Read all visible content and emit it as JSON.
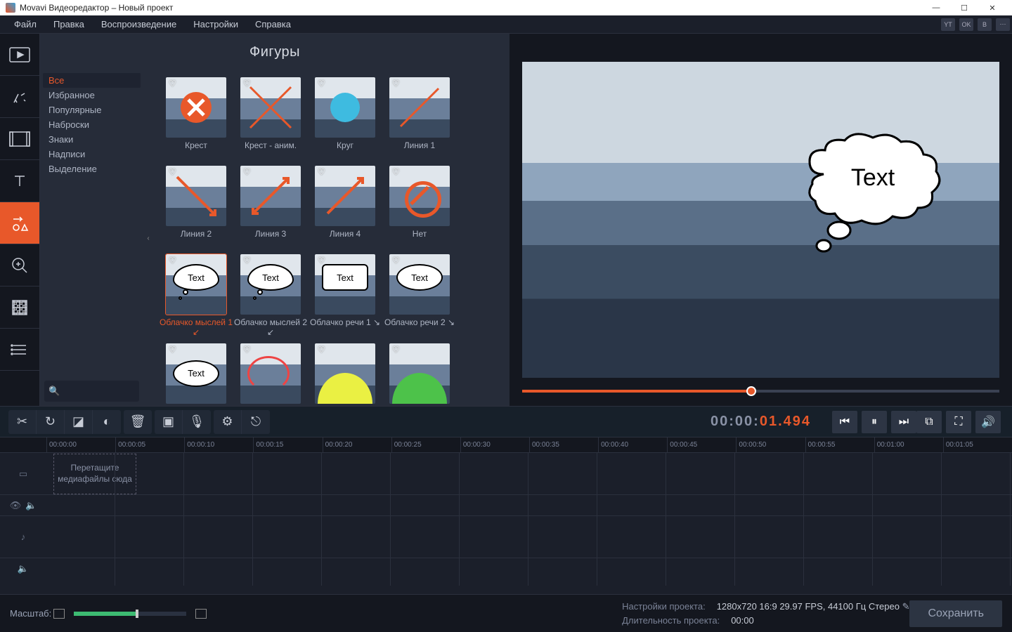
{
  "window": {
    "title": "Movavi Видеоредактор – Новый проект"
  },
  "menu": {
    "items": [
      "Файл",
      "Правка",
      "Воспроизведение",
      "Настройки",
      "Справка"
    ]
  },
  "panel": {
    "title": "Фигуры",
    "categories": [
      "Все",
      "Избранное",
      "Популярные",
      "Наброски",
      "Знаки",
      "Надписи",
      "Выделение"
    ],
    "selected_category": 0,
    "items": [
      {
        "label": "Крест",
        "kind": "cross-x"
      },
      {
        "label": "Крест - аним.",
        "kind": "cross-lines"
      },
      {
        "label": "Круг",
        "kind": "circle"
      },
      {
        "label": "Линия 1",
        "kind": "line1"
      },
      {
        "label": "Линия 2",
        "kind": "line2"
      },
      {
        "label": "Линия 3",
        "kind": "line3"
      },
      {
        "label": "Линия 4",
        "kind": "line4"
      },
      {
        "label": "Нет",
        "kind": "nosign"
      },
      {
        "label": "Облачко мыслей 1 ↙",
        "kind": "cloud",
        "selected": true
      },
      {
        "label": "Облачко мыслей 2 ↙",
        "kind": "cloud"
      },
      {
        "label": "Облачко речи 1 ↘",
        "kind": "rect"
      },
      {
        "label": "Облачко речи 2 ↘",
        "kind": "oval"
      },
      {
        "label": "",
        "kind": "oval2"
      },
      {
        "label": "",
        "kind": "circ-r"
      },
      {
        "label": "",
        "kind": "blob-y"
      },
      {
        "label": "",
        "kind": "blob-g"
      }
    ],
    "bubble_text": "Text"
  },
  "preview": {
    "bubble_text": "Text",
    "scrub_pct": 48,
    "timecode_gray": "00:00:",
    "timecode_orange": "01.494"
  },
  "ruler": [
    "00:00:00",
    "00:00:05",
    "00:00:10",
    "00:00:15",
    "00:00:20",
    "00:00:25",
    "00:00:30",
    "00:00:35",
    "00:00:40",
    "00:00:45",
    "00:00:50",
    "00:00:55",
    "00:01:00",
    "00:01:05"
  ],
  "dropzone": "Перетащите медиафайлы сюда",
  "status": {
    "scale_label": "Масштаб:",
    "settings_label": "Настройки проекта:",
    "settings_value": "1280x720 16:9 29.97 FPS, 44100 Гц Стерео",
    "duration_label": "Длительность проекта:",
    "duration_value": "00:00",
    "save": "Сохранить"
  }
}
